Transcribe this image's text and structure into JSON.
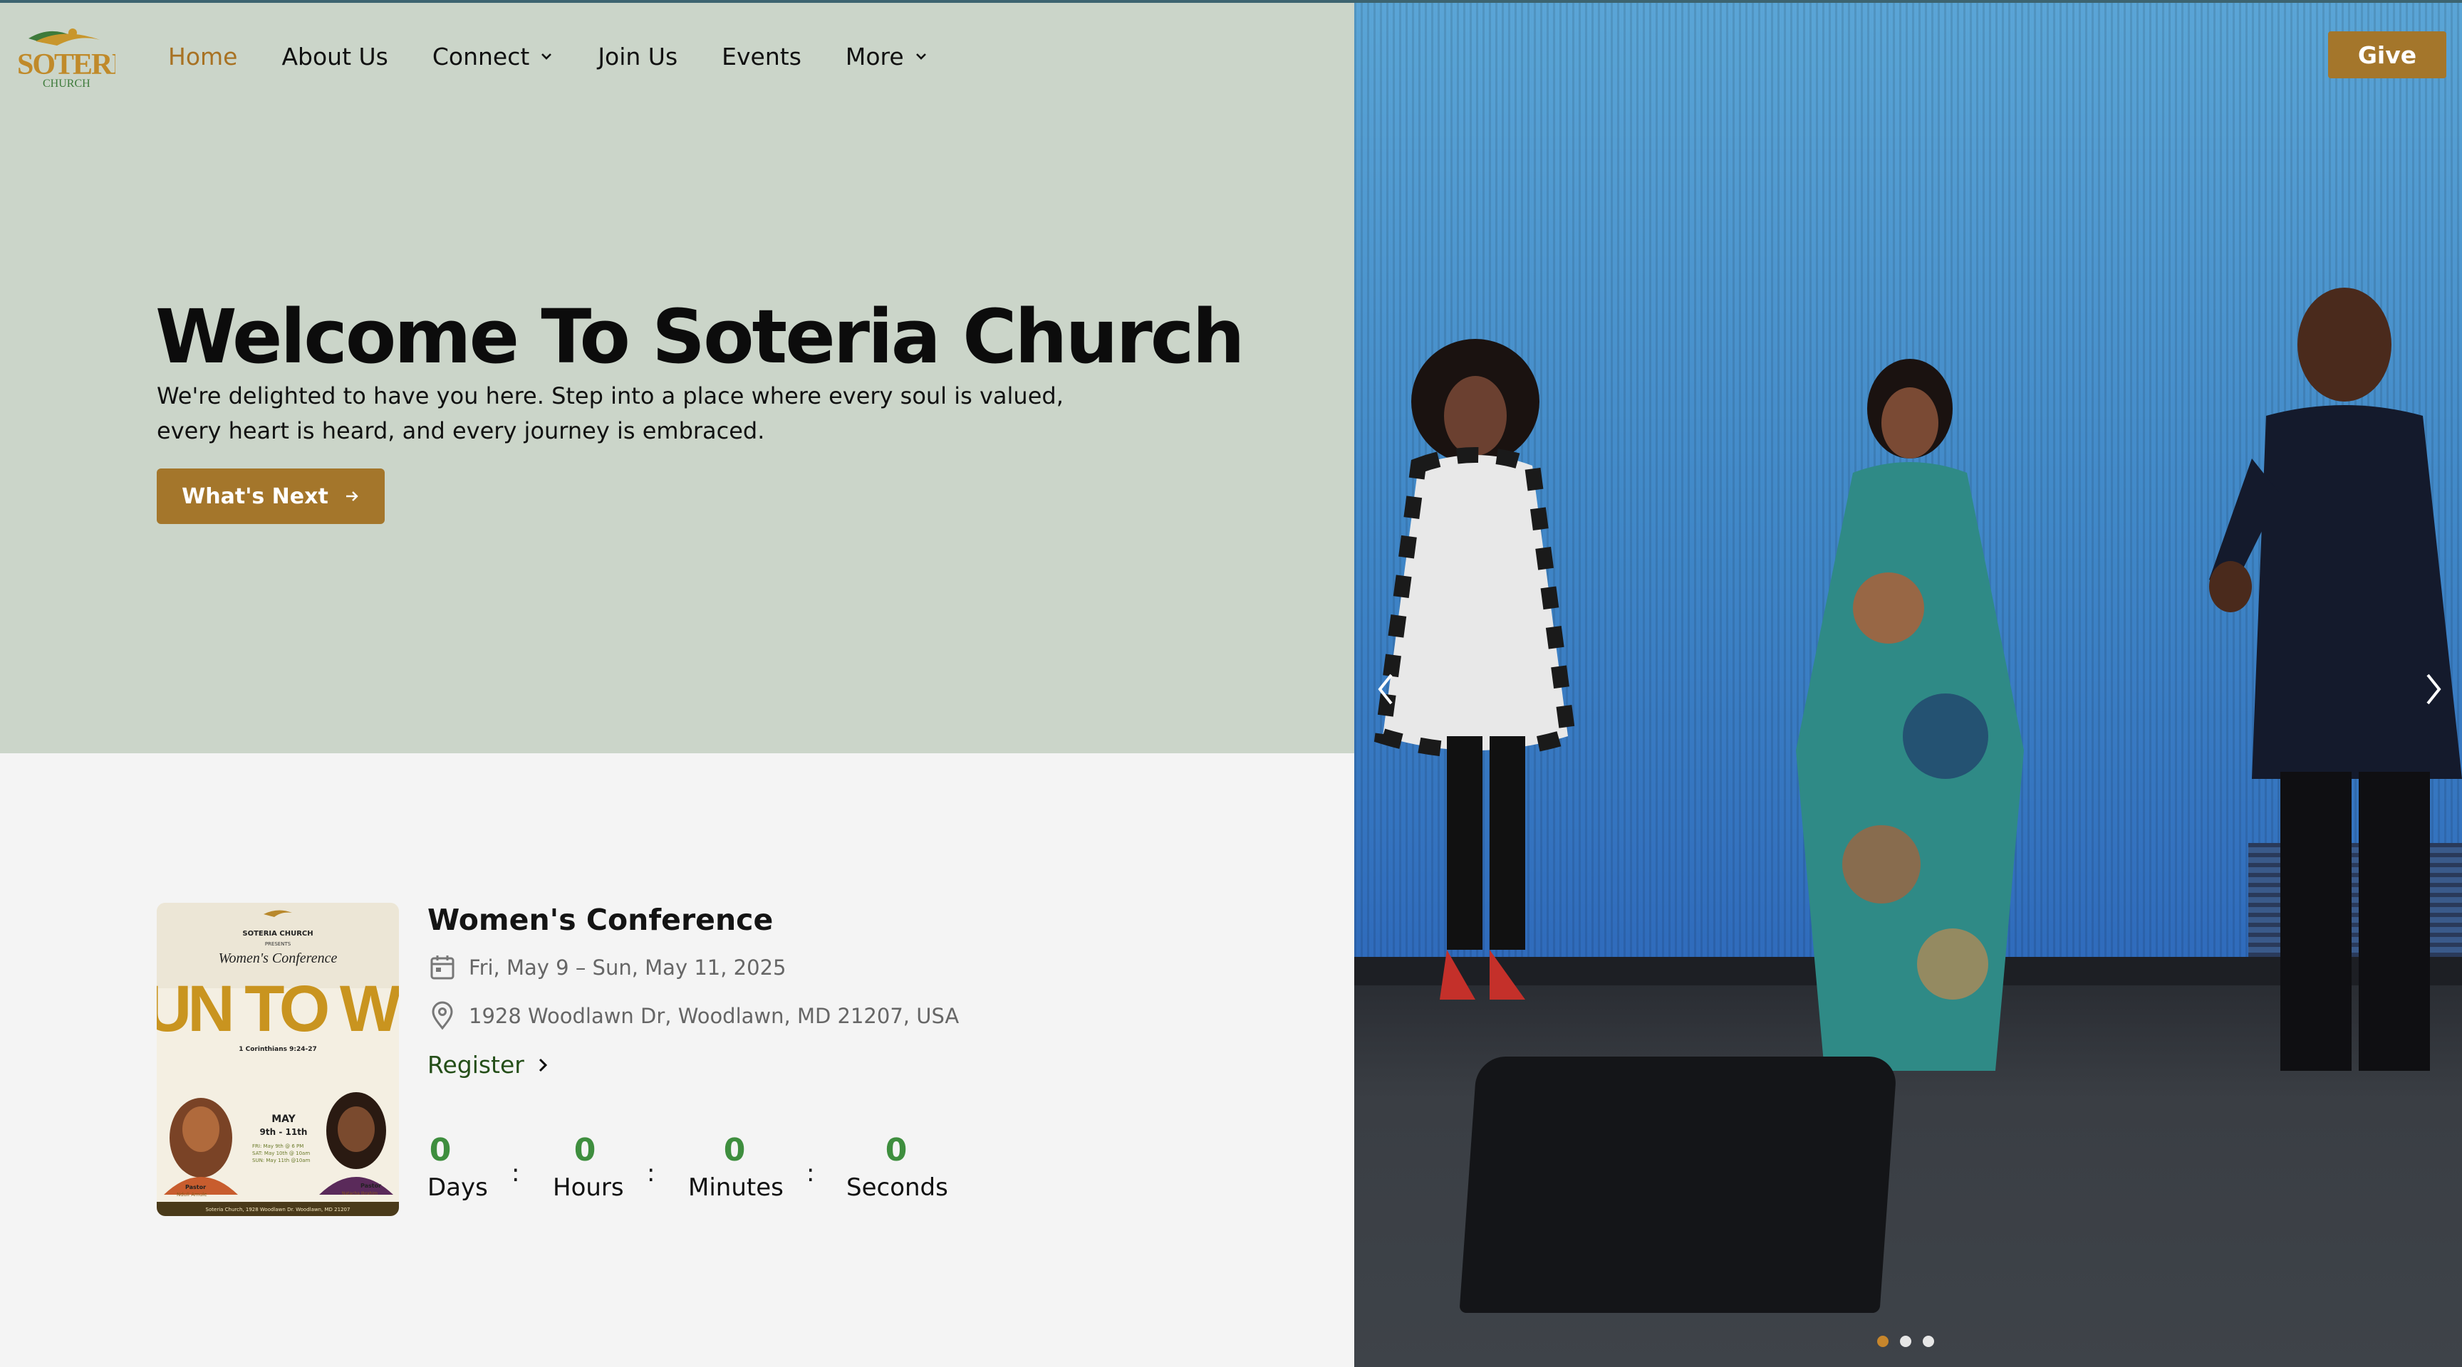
{
  "brand": {
    "logo_text": "SOTERIA",
    "logo_subtext": "CHURCH",
    "accent_color": "#a4762b",
    "logo_icon": "dove-swoosh-icon"
  },
  "nav": {
    "items": [
      {
        "label": "Home",
        "active": true,
        "dropdown": false
      },
      {
        "label": "About Us",
        "active": false,
        "dropdown": false
      },
      {
        "label": "Connect",
        "active": false,
        "dropdown": true
      },
      {
        "label": "Join Us",
        "active": false,
        "dropdown": false
      },
      {
        "label": "Events",
        "active": false,
        "dropdown": false
      },
      {
        "label": "More",
        "active": false,
        "dropdown": true
      }
    ],
    "give_label": "Give"
  },
  "hero": {
    "title": "Welcome To Soteria Church",
    "subtitle": "We're delighted to have you here. Step into a place where every soul is valued, every heart is heard, and every journey is embraced.",
    "cta_label": "What's Next"
  },
  "event": {
    "title": "Women's Conference",
    "date": "Fri, May 9 – Sun, May 11, 2025",
    "location": "1928 Woodlawn Dr, Woodlawn, MD 21207, USA",
    "register_label": "Register",
    "poster": {
      "org": "SOTERIA CHURCH",
      "presents": "PRESENTS",
      "event_script": "Women's Conference",
      "headline": "RUN TO WIN",
      "verse": "1 Corinthians 9:24-27",
      "month": "MAY",
      "days": "9th - 11th",
      "schedule": [
        "FRI: May 9th @ 6 PM",
        "SAT: May 10th @ 10am",
        "SUN: May 11th @10am"
      ],
      "speaker_left": "Pastor",
      "speaker_left_name": "Nduli Amule",
      "speaker_right": "Pastor",
      "speaker_right_name": "Natacha Ibrahim",
      "footer": "Soteria Church, 1928 Woodlawn Dr. Woodlawn, MD 21207"
    },
    "countdown": [
      {
        "value": "0",
        "label": "Days"
      },
      {
        "value": "0",
        "label": "Hours"
      },
      {
        "value": "0",
        "label": "Minutes"
      },
      {
        "value": "0",
        "label": "Seconds"
      }
    ],
    "separator": ":"
  },
  "slider": {
    "slide_count": 3,
    "active_index": 0
  }
}
